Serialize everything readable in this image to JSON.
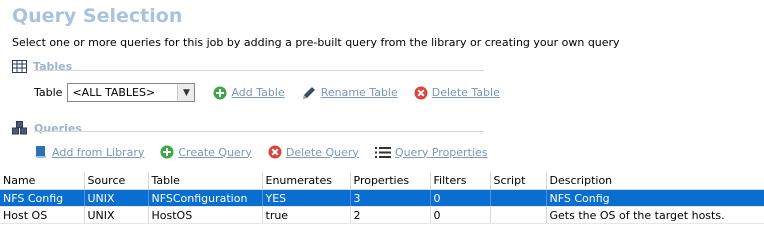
{
  "page": {
    "title": "Query Selection",
    "subtitle": "Select one or more queries for this job by adding a pre-built query from the library or creating your own query"
  },
  "tables_section": {
    "heading": "Tables",
    "table_label": "Table",
    "table_select_value": "<ALL TABLES>",
    "add_table": "Add Table",
    "rename_table": "Rename Table",
    "delete_table": "Delete Table"
  },
  "queries_section": {
    "heading": "Queries",
    "add_from_library": "Add from Library",
    "create_query": "Create Query",
    "delete_query": "Delete Query",
    "query_properties": "Query Properties"
  },
  "grid": {
    "columns": [
      "Name",
      "Source",
      "Table",
      "Enumerates",
      "Properties",
      "Filters",
      "Script",
      "Description"
    ],
    "rows": [
      [
        "NFS Config",
        "UNIX",
        "NFSConfiguration",
        "YES",
        "3",
        "0",
        "",
        "NFS Config"
      ],
      [
        "Host OS",
        "UNIX",
        "HostOS",
        "true",
        "2",
        "0",
        "",
        "Gets the OS of the target hosts."
      ]
    ],
    "selected_row": 0
  },
  "colors": {
    "title": "#a8c3de",
    "section_heading": "#9fb4cc",
    "link": "#7a96b8",
    "selection": "#0a6ed1",
    "add_green": "#3aa845",
    "delete_red": "#d9453d"
  },
  "icons": [
    "table-grid-icon",
    "add-icon",
    "pencil-icon",
    "delete-icon",
    "queries-cubes-icon",
    "book-icon",
    "properties-list-icon",
    "dropdown-arrow-icon"
  ]
}
